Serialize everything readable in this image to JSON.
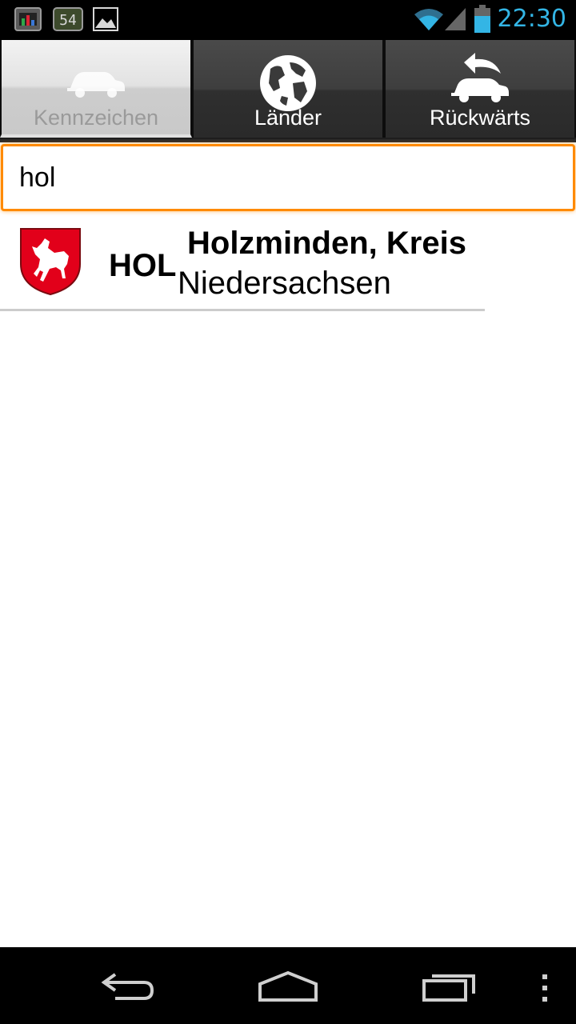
{
  "status_bar": {
    "time": "22:30",
    "notification_count": "54",
    "icons": [
      "chart-app-icon",
      "counter-54-icon",
      "image-icon",
      "wifi-icon",
      "signal-icon",
      "battery-icon"
    ]
  },
  "tabs": [
    {
      "label": "Kennzeichen",
      "icon": "car-icon",
      "active": true
    },
    {
      "label": "Länder",
      "icon": "globe-icon",
      "active": false
    },
    {
      "label": "Rückwärts",
      "icon": "car-back-arrow-icon",
      "active": false
    }
  ],
  "search": {
    "value": "hol"
  },
  "results": [
    {
      "code": "HOL",
      "name": "Holzminden, Kreis",
      "region": "Niedersachsen",
      "crest": "lower-saxony-horse-crest-icon"
    }
  ],
  "colors": {
    "accent_time": "#33b5e5",
    "input_focus": "#ff8a00",
    "crest_red": "#e2001a"
  }
}
